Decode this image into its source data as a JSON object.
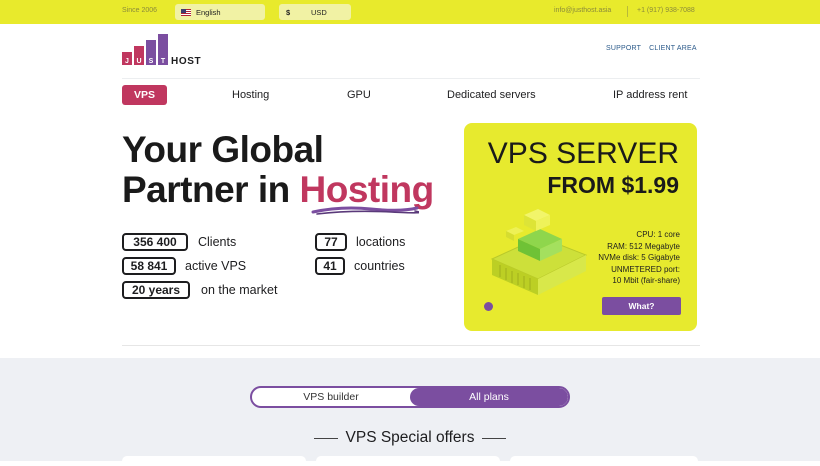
{
  "topbar": {
    "since": "Since 2006",
    "language": "English",
    "currency_symbol": "$",
    "currency_code": "USD",
    "email": "info@justhost.asia",
    "phone": "+1 (917) 938-7088"
  },
  "header": {
    "logo_letters": [
      "J",
      "U",
      "S",
      "T"
    ],
    "logo_host": "HOST",
    "links": [
      "SUPPORT",
      "CLIENT AREA"
    ]
  },
  "nav": {
    "items": [
      "VPS",
      "Hosting",
      "GPU",
      "Dedicated servers",
      "IP address rent"
    ],
    "active": "VPS"
  },
  "hero": {
    "title_line1": "Your Global",
    "title_line2": "Partner in",
    "title_accent": "Hosting",
    "stats": [
      {
        "value": "356 400",
        "label": "Clients"
      },
      {
        "value": "58 841",
        "label": "active VPS"
      },
      {
        "value": "20 years",
        "label": "on the market"
      },
      {
        "value": "77",
        "label": "locations"
      },
      {
        "value": "41",
        "label": "countries"
      }
    ]
  },
  "promo": {
    "title": "VPS SERVER",
    "price": "FROM $1.99",
    "specs": [
      "CPU: 1 core",
      "RAM: 512 Megabyte",
      "NVMe disk: 5 Gigabyte",
      "UNMETERED port:",
      "10 Mbit (fair-share)"
    ],
    "button": "What?"
  },
  "lower": {
    "toggle_left": "VPS builder",
    "toggle_right": "All plans",
    "offers_title": "VPS Special offers"
  },
  "colors": {
    "yellow": "#e8ea2c",
    "accent_pink": "#c0375f",
    "accent_purple": "#7b4ea0"
  }
}
